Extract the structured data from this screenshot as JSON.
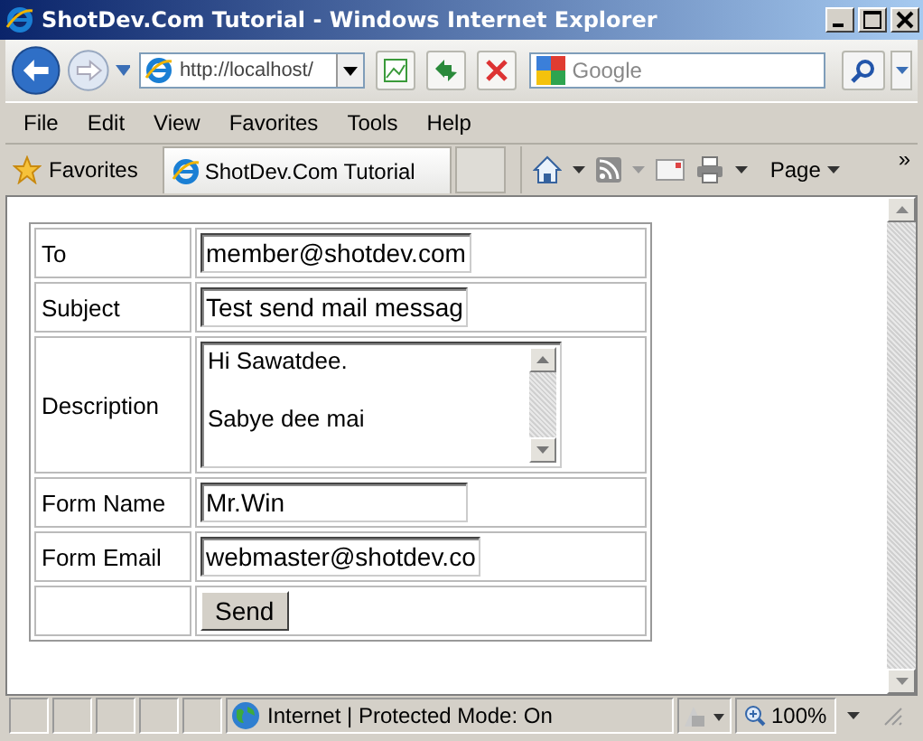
{
  "window": {
    "title": "ShotDev.Com Tutorial - Windows Internet Explorer"
  },
  "address_bar": {
    "url": "http://localhost/"
  },
  "search": {
    "placeholder": "Google"
  },
  "menu": [
    "File",
    "Edit",
    "View",
    "Favorites",
    "Tools",
    "Help"
  ],
  "favorites_bar": {
    "favorites": "Favorites",
    "tabs": [
      {
        "label": "ShotDev.Com Tutorial",
        "selected": true
      }
    ],
    "page_menu": "Page",
    "more": "»"
  },
  "form": {
    "rows": [
      {
        "kind": "text",
        "label": "To",
        "value": "member@shotdev.com"
      },
      {
        "kind": "text",
        "label": "Subject",
        "value": "Test send mail messag"
      },
      {
        "kind": "textarea",
        "label": "Description",
        "paragraphs": [
          "Hi Sawatdee.",
          "Sabye dee mai"
        ]
      },
      {
        "kind": "text",
        "label": "Form Name",
        "value": "Mr.Win"
      },
      {
        "kind": "text",
        "label": "Form Email",
        "value": "webmaster@shotdev.co"
      },
      {
        "kind": "button",
        "value": "Send"
      }
    ]
  },
  "status_bar": {
    "zone": "Internet | Protected Mode: On",
    "zoom": "100%"
  }
}
